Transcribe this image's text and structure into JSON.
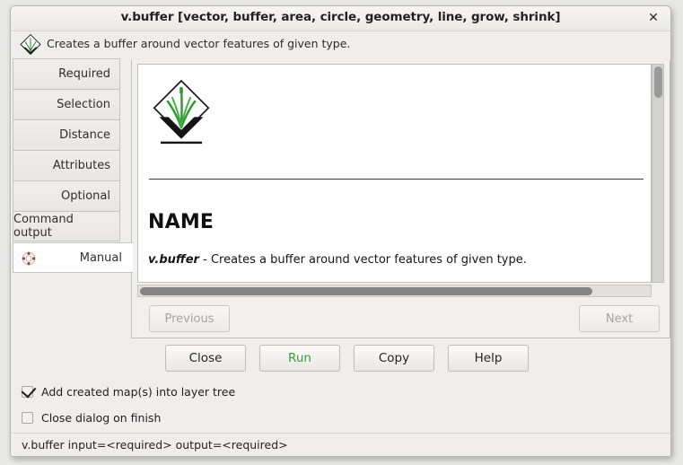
{
  "window": {
    "title": "v.buffer [vector, buffer, area, circle, geometry, line, grow, shrink]",
    "close_label": "✕",
    "header_description": "Creates a buffer around vector features of given type.",
    "header_icon": "grass-logo-icon"
  },
  "tabs": [
    {
      "label": "Required",
      "selected": false,
      "icon": null
    },
    {
      "label": "Selection",
      "selected": false,
      "icon": null
    },
    {
      "label": "Distance",
      "selected": false,
      "icon": null
    },
    {
      "label": "Attributes",
      "selected": false,
      "icon": null
    },
    {
      "label": "Optional",
      "selected": false,
      "icon": null
    },
    {
      "label": "Command output",
      "selected": false,
      "icon": null
    },
    {
      "label": "Manual",
      "selected": true,
      "icon": "lifebuoy-icon"
    }
  ],
  "manual": {
    "logo": "grass-logo-icon",
    "heading": "NAME",
    "command_name": "v.buffer",
    "command_dash": " - ",
    "command_description": "Creates a buffer around vector features of given type.",
    "prev_label": "Previous",
    "next_label": "Next",
    "prev_enabled": false,
    "next_enabled": false,
    "vscroll_thumb_pct": 14,
    "hscroll_thumb_pct": 88
  },
  "actions": {
    "close_label": "Close",
    "run_label": "Run",
    "copy_label": "Copy",
    "help_label": "Help"
  },
  "options": [
    {
      "label": "Add created map(s) into layer tree",
      "checked": true
    },
    {
      "label": "Close dialog on finish",
      "checked": false
    }
  ],
  "statusbar": {
    "command": "v.buffer input=<required> output=<required>"
  },
  "colors": {
    "run_green": "#3d9b3d",
    "window_bg": "#efeeec",
    "panel_bg": "#f1f0ee",
    "doc_bg": "#ffffff",
    "tab_border": "#c7c5c1",
    "disabled_text": "#a6a3a0",
    "lifebuoy_red": "#b03a3a"
  }
}
